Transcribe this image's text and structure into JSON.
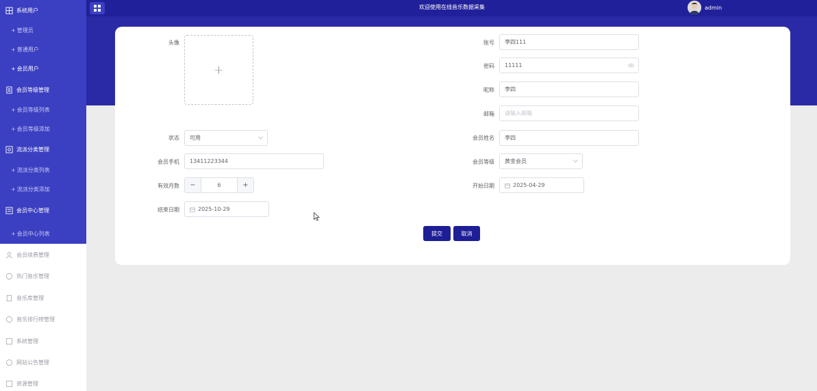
{
  "header": {
    "welcome": "欢迎使用在线音乐数据采集",
    "username": "admin"
  },
  "sidebar": {
    "groups": [
      {
        "label": "系统用户",
        "icon": "grid-icon",
        "children": [
          {
            "label": "管理员"
          },
          {
            "label": "普通用户"
          },
          {
            "label": "会员用户",
            "active": true
          }
        ]
      },
      {
        "label": "会员等级管理",
        "icon": "document-icon",
        "children": [
          {
            "label": "会员等级列表"
          },
          {
            "label": "会员等级添加"
          }
        ]
      },
      {
        "label": "流派分类管理",
        "icon": "share-icon",
        "children": [
          {
            "label": "流派分类列表"
          },
          {
            "label": "流派分类添加"
          }
        ]
      },
      {
        "label": "会员中心管理",
        "icon": "list-icon",
        "children": [
          {
            "label": "会员中心列表"
          }
        ]
      }
    ],
    "plain_items": [
      {
        "label": "会员续费管理",
        "icon": "user-icon"
      },
      {
        "label": "热门音乐管理",
        "icon": "chat-icon"
      },
      {
        "label": "音乐库管理",
        "icon": "document-icon"
      },
      {
        "label": "音乐排行榜管理",
        "icon": "chat-icon"
      },
      {
        "label": "系统管理",
        "icon": "grid-icon"
      },
      {
        "label": "网站公告管理",
        "icon": "chat-icon"
      },
      {
        "label": "资源管理",
        "icon": "grid-icon"
      }
    ]
  },
  "form": {
    "avatar": {
      "label": "头像",
      "upload_symbol": "+"
    },
    "status": {
      "label": "状态",
      "value": "可用"
    },
    "phone": {
      "label": "会员手机",
      "value": "13411223344"
    },
    "months": {
      "label": "有效月数",
      "value": "6",
      "minus": "−",
      "plus": "+"
    },
    "end_date": {
      "label": "结束日期",
      "value": "2025-10-29"
    },
    "account": {
      "label": "账号",
      "value": "李四111"
    },
    "password": {
      "label": "密码",
      "value": "11111"
    },
    "nickname": {
      "label": "昵称",
      "value": "李四"
    },
    "email": {
      "label": "邮箱",
      "placeholder": "请输入邮箱"
    },
    "member_name": {
      "label": "会员姓名",
      "value": "李四"
    },
    "member_level": {
      "label": "会员等级",
      "value": "黄金会员"
    },
    "start_date": {
      "label": "开始日期",
      "value": "2025-04-29"
    }
  },
  "actions": {
    "submit": "提交",
    "cancel": "取消"
  },
  "colors": {
    "sidebar_accent": "#3b3fc1",
    "header": "#20209a",
    "primary_button": "#1e1e96"
  }
}
